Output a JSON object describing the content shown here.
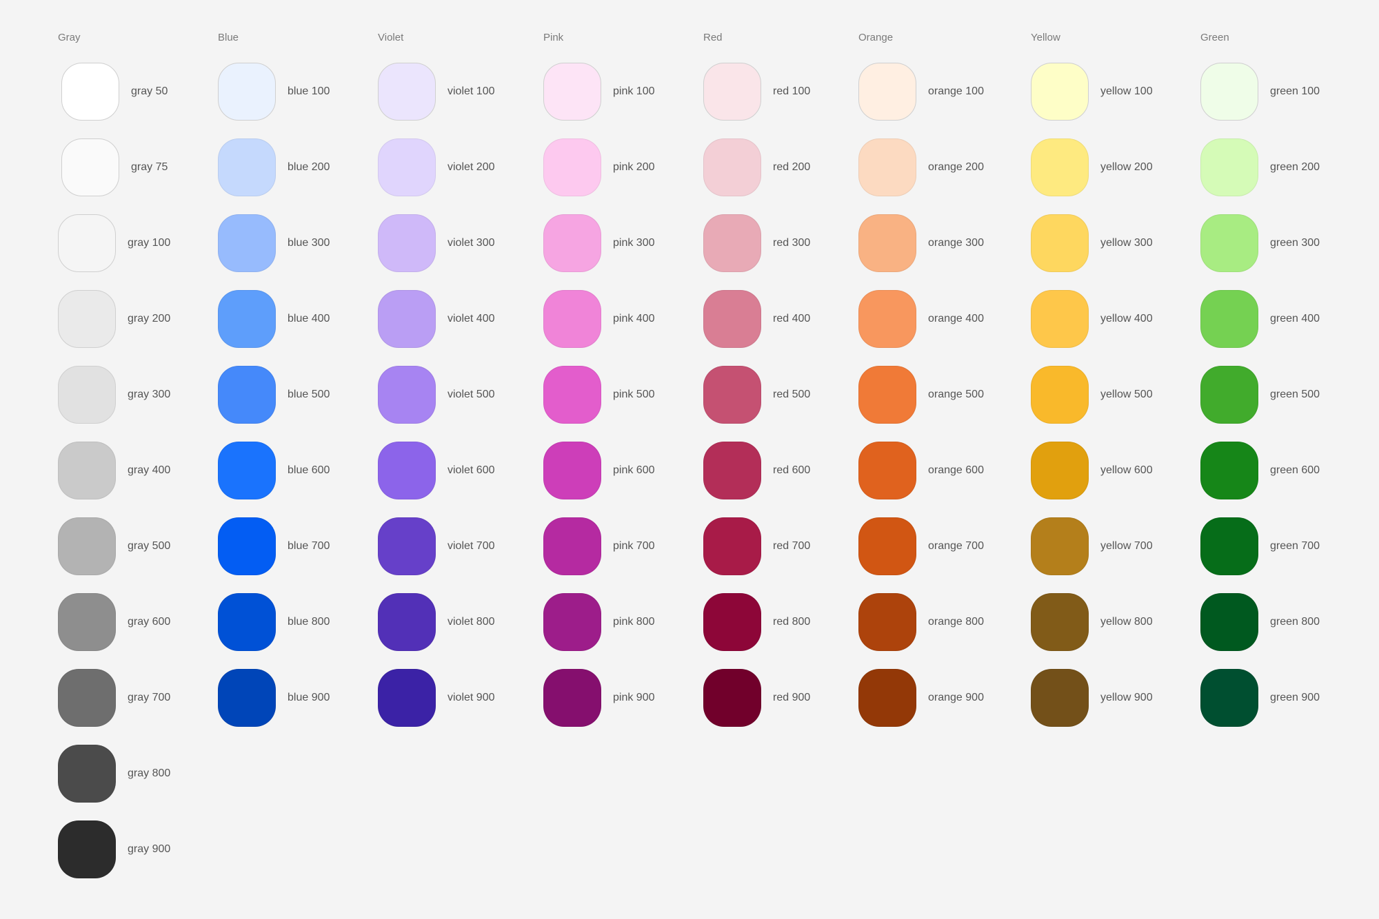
{
  "palette": {
    "columns": [
      {
        "title": "Gray",
        "swatches": [
          {
            "label": "gray 50",
            "color": "#ffffff"
          },
          {
            "label": "gray 75",
            "color": "#fafafa"
          },
          {
            "label": "gray 100",
            "color": "#f5f5f5"
          },
          {
            "label": "gray 200",
            "color": "#eaeaea"
          },
          {
            "label": "gray 300",
            "color": "#e1e1e1"
          },
          {
            "label": "gray 400",
            "color": "#cacaca"
          },
          {
            "label": "gray 500",
            "color": "#b3b3b3"
          },
          {
            "label": "gray 600",
            "color": "#8e8e8e"
          },
          {
            "label": "gray 700",
            "color": "#6e6e6e"
          },
          {
            "label": "gray 800",
            "color": "#4b4b4b"
          },
          {
            "label": "gray 900",
            "color": "#2c2c2c"
          }
        ]
      },
      {
        "title": "Blue",
        "swatches": [
          {
            "label": "blue 100",
            "color": "#eaf2fe"
          },
          {
            "label": "blue 200",
            "color": "#c5d9fd"
          },
          {
            "label": "blue 300",
            "color": "#97bbfd"
          },
          {
            "label": "blue 400",
            "color": "#5e9efb"
          },
          {
            "label": "blue 500",
            "color": "#4589fa"
          },
          {
            "label": "blue 600",
            "color": "#1a73fd"
          },
          {
            "label": "blue 700",
            "color": "#035df3"
          },
          {
            "label": "blue 800",
            "color": "#0051d6"
          },
          {
            "label": "blue 900",
            "color": "#0045b8"
          }
        ]
      },
      {
        "title": "Violet",
        "swatches": [
          {
            "label": "violet 100",
            "color": "#ebe5fd"
          },
          {
            "label": "violet 200",
            "color": "#e0d5fd"
          },
          {
            "label": "violet 300",
            "color": "#cfb9f9"
          },
          {
            "label": "violet 400",
            "color": "#ba9ef4"
          },
          {
            "label": "violet 500",
            "color": "#a784f2"
          },
          {
            "label": "violet 600",
            "color": "#8c64ea"
          },
          {
            "label": "violet 700",
            "color": "#6640c9"
          },
          {
            "label": "violet 800",
            "color": "#5230b7"
          },
          {
            "label": "violet 900",
            "color": "#3b22a6"
          }
        ]
      },
      {
        "title": "Pink",
        "swatches": [
          {
            "label": "pink 100",
            "color": "#fde4f6"
          },
          {
            "label": "pink 200",
            "color": "#fdc9ef"
          },
          {
            "label": "pink 300",
            "color": "#f6a5e2"
          },
          {
            "label": "pink 400",
            "color": "#f084d8"
          },
          {
            "label": "pink 500",
            "color": "#e35dcc"
          },
          {
            "label": "pink 600",
            "color": "#cd3eb9"
          },
          {
            "label": "pink 700",
            "color": "#b52aa1"
          },
          {
            "label": "pink 800",
            "color": "#9d1d8a"
          },
          {
            "label": "pink 900",
            "color": "#850f6e"
          }
        ]
      },
      {
        "title": "Red",
        "swatches": [
          {
            "label": "red 100",
            "color": "#fae5e9"
          },
          {
            "label": "red 200",
            "color": "#f3cfd6"
          },
          {
            "label": "red 300",
            "color": "#e8aab6"
          },
          {
            "label": "red 400",
            "color": "#d97e94"
          },
          {
            "label": "red 500",
            "color": "#c55172"
          },
          {
            "label": "red 600",
            "color": "#b32e58"
          },
          {
            "label": "red 700",
            "color": "#a81b48"
          },
          {
            "label": "red 800",
            "color": "#8d0638"
          },
          {
            "label": "red 900",
            "color": "#71002b"
          }
        ]
      },
      {
        "title": "Orange",
        "swatches": [
          {
            "label": "orange 100",
            "color": "#ffefe2"
          },
          {
            "label": "orange 200",
            "color": "#fcdac1"
          },
          {
            "label": "orange 300",
            "color": "#f9b283"
          },
          {
            "label": "orange 400",
            "color": "#f8975e"
          },
          {
            "label": "orange 500",
            "color": "#f07a37"
          },
          {
            "label": "orange 600",
            "color": "#e0621e"
          },
          {
            "label": "orange 700",
            "color": "#d15613"
          },
          {
            "label": "orange 800",
            "color": "#ad430c"
          },
          {
            "label": "orange 900",
            "color": "#933807"
          }
        ]
      },
      {
        "title": "Yellow",
        "swatches": [
          {
            "label": "yellow 100",
            "color": "#fefec7"
          },
          {
            "label": "yellow 200",
            "color": "#feea80"
          },
          {
            "label": "yellow 300",
            "color": "#fed75f"
          },
          {
            "label": "yellow 400",
            "color": "#fec74a"
          },
          {
            "label": "yellow 500",
            "color": "#f9b92b"
          },
          {
            "label": "yellow 600",
            "color": "#e1a00e"
          },
          {
            "label": "yellow 700",
            "color": "#b47f1b"
          },
          {
            "label": "yellow 800",
            "color": "#815b18"
          },
          {
            "label": "yellow 900",
            "color": "#735019"
          }
        ]
      },
      {
        "title": "Green",
        "swatches": [
          {
            "label": "green 100",
            "color": "#effde8"
          },
          {
            "label": "green 200",
            "color": "#d5fbb7"
          },
          {
            "label": "green 300",
            "color": "#a8ec82"
          },
          {
            "label": "green 400",
            "color": "#75d152"
          },
          {
            "label": "green 500",
            "color": "#41ab2c"
          },
          {
            "label": "green 600",
            "color": "#168618"
          },
          {
            "label": "green 700",
            "color": "#066d19"
          },
          {
            "label": "green 800",
            "color": "#00591f"
          },
          {
            "label": "green 900",
            "color": "#004f30"
          }
        ]
      }
    ]
  }
}
